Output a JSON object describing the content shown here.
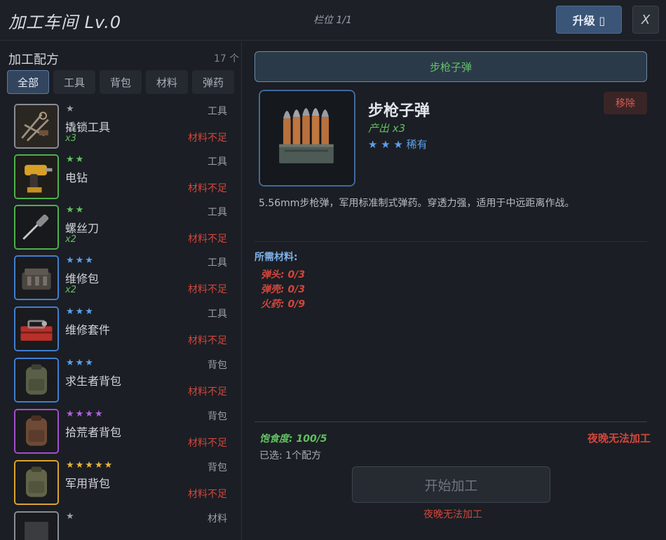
{
  "header": {
    "title": "加工车间 Lv.0",
    "slot": "栏位 1/1",
    "upgrade_label": "升级 ▯",
    "close_label": "X"
  },
  "recipes": {
    "title": "加工配方",
    "count": "17 个",
    "tabs": [
      {
        "label": "全部",
        "active": true
      },
      {
        "label": "工具",
        "active": false
      },
      {
        "label": "背包",
        "active": false
      },
      {
        "label": "材料",
        "active": false
      },
      {
        "label": "弹药",
        "active": false
      }
    ],
    "items": [
      {
        "name": "撬锁工具",
        "stars": "★",
        "star_color": "#9aa0a8",
        "qty": "x3",
        "category": "工具",
        "status": "材料不足",
        "border": "#8a8d92",
        "icon": "lockpick-icon"
      },
      {
        "name": "电钻",
        "stars": "★★",
        "star_color": "#5fc05f",
        "qty": "",
        "category": "工具",
        "status": "材料不足",
        "border": "#4db04d",
        "icon": "drill-icon"
      },
      {
        "name": "螺丝刀",
        "stars": "★★",
        "star_color": "#5fc05f",
        "qty": "x2",
        "category": "工具",
        "status": "材料不足",
        "border": "#4db04d",
        "icon": "screwdriver-icon"
      },
      {
        "name": "维修包",
        "stars": "★★★",
        "star_color": "#5aa0ea",
        "qty": "x2",
        "category": "工具",
        "status": "材料不足",
        "border": "#3f7fd0",
        "icon": "repair-kit-icon"
      },
      {
        "name": "维修套件",
        "stars": "★★★",
        "star_color": "#5aa0ea",
        "qty": "",
        "category": "工具",
        "status": "材料不足",
        "border": "#3f7fd0",
        "icon": "toolbox-icon"
      },
      {
        "name": "求生者背包",
        "stars": "★★★",
        "star_color": "#5aa0ea",
        "qty": "",
        "category": "背包",
        "status": "材料不足",
        "border": "#3f7fd0",
        "icon": "backpack-icon"
      },
      {
        "name": "拾荒者背包",
        "stars": "★★★★",
        "star_color": "#b45ee0",
        "qty": "",
        "category": "背包",
        "status": "材料不足",
        "border": "#a24fd0",
        "icon": "backpack-icon"
      },
      {
        "name": "军用背包",
        "stars": "★★★★★",
        "star_color": "#e6b43a",
        "qty": "",
        "category": "背包",
        "status": "材料不足",
        "border": "#d9a431",
        "icon": "backpack-icon"
      },
      {
        "name": "",
        "stars": "★",
        "star_color": "#9aa0a8",
        "qty": "",
        "category": "材料",
        "status": "",
        "border": "#8a8d92",
        "icon": "material-icon"
      }
    ]
  },
  "detail": {
    "selected_label": "步枪子弹",
    "name": "步枪子弹",
    "output": "产出 x3",
    "rarity": "★ ★ ★ 稀有",
    "remove_label": "移除",
    "description": "5.56mm步枪弹，军用标准制式弹药。穿透力强，适用于中远距离作战。",
    "materials_title": "所需材料:",
    "materials": [
      "弹头: 0/3",
      "弹壳: 0/3",
      "火药: 0/9"
    ],
    "icon": "rifle-ammo-icon"
  },
  "footer": {
    "satiety": "饱食度: 100/5",
    "selected_count": "已选: 1个配方",
    "night_warning": "夜晚无法加工",
    "start_label": "开始加工",
    "start_hint": "夜晚无法加工"
  }
}
